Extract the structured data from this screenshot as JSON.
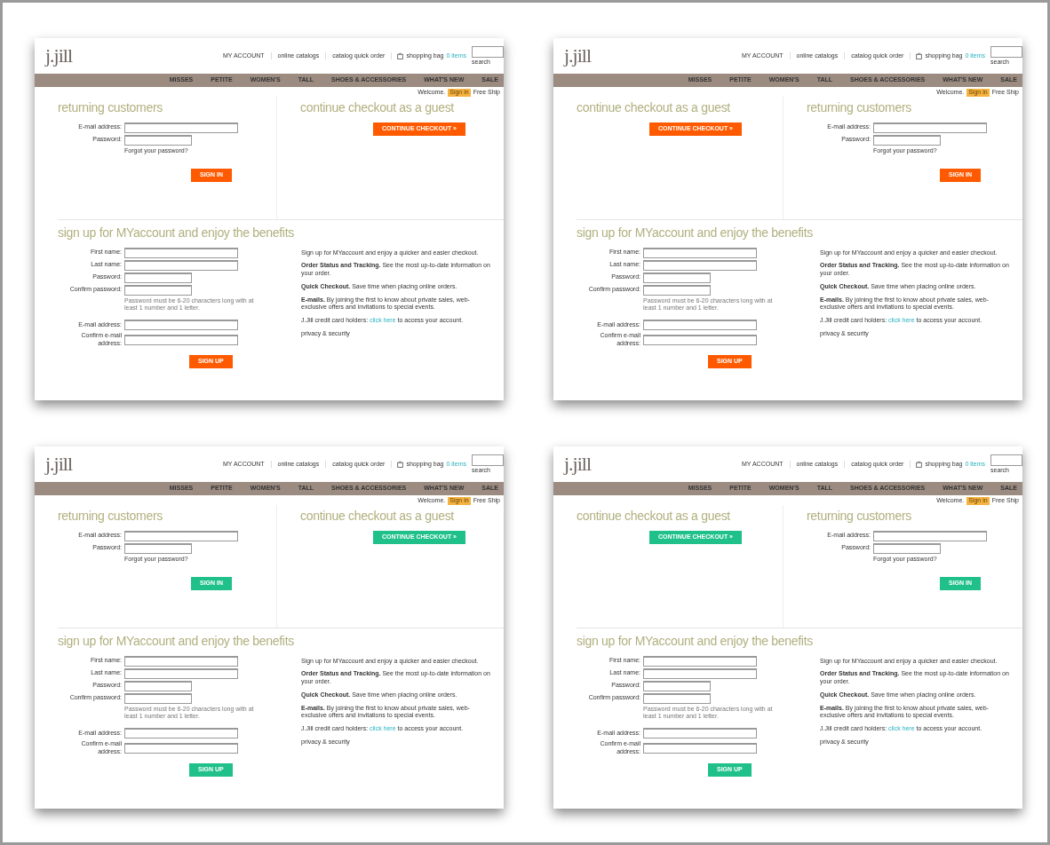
{
  "panels": [
    {
      "color": "#ff5a00",
      "logo": "j.jill",
      "utility_links": [
        "MY ACCOUNT",
        "online catalogs",
        "catalog quick order"
      ],
      "bag_label": "shopping bag",
      "bag_count": "0 items",
      "search_label": "search",
      "nav": [
        "MISSES",
        "PETITE",
        "WOMEN'S",
        "TALL",
        "SHOES & ACCESSORIES",
        "WHAT'S NEW",
        "SALE"
      ],
      "welcome": "Welcome.",
      "sign_in_link": "Sign in",
      "promo": "Free Ship",
      "sections": [
        {
          "kind": "returning",
          "heading": "returning customers",
          "fields": [
            "E-mail address:",
            "Password:"
          ],
          "forgot": "Forgot your password?",
          "button": "SIGN IN"
        },
        {
          "kind": "guest",
          "heading": "continue checkout as a guest",
          "button": "CONTINUE CHECKOUT »"
        }
      ],
      "signup": {
        "heading": "sign up for MYaccount and enjoy the benefits",
        "fields": [
          "First name:",
          "Last name:",
          "Password:",
          "Confirm password:"
        ],
        "hint": "Password must be 6-20 characters long with at least 1 number and 1 letter.",
        "email_fields": [
          "E-mail address:",
          "Confirm e-mail address:"
        ],
        "button": "SIGN UP",
        "intro": "Sign up for MYaccount and enjoy a quicker and easier checkout.",
        "benefits": [
          "**Order Status and Tracking.** See the most up-to-date information on your order.",
          "**Quick Checkout.** Save time when placing online orders.",
          "**E-mails.** By joining the first to know about private sales, web-exclusive offers and invitations to special events."
        ],
        "card_note": {
          "before": "J.Jill credit card holders:",
          "link": "click here",
          "after": "to access your account."
        },
        "privacy": "privacy & security"
      }
    },
    {
      "color": "#ff5a00",
      "logo": "j.jill",
      "utility_links": [
        "MY ACCOUNT",
        "online catalogs",
        "catalog quick order"
      ],
      "bag_label": "shopping bag",
      "bag_count": "0 items",
      "search_label": "search",
      "nav": [
        "MISSES",
        "PETITE",
        "WOMEN'S",
        "TALL",
        "SHOES & ACCESSORIES",
        "WHAT'S NEW",
        "SALE"
      ],
      "welcome": "Welcome.",
      "sign_in_link": "Sign in",
      "promo": "Free Ship",
      "sections": [
        {
          "kind": "guest",
          "heading": "continue checkout as a guest",
          "button": "CONTINUE CHECKOUT »"
        },
        {
          "kind": "returning",
          "heading": "returning customers",
          "fields": [
            "E-mail address:",
            "Password:"
          ],
          "forgot": "Forgot your password?",
          "button": "SIGN IN"
        }
      ],
      "signup": {
        "heading": "sign up for MYaccount and enjoy the benefits",
        "fields": [
          "First name:",
          "Last name:",
          "Password:",
          "Confirm password:"
        ],
        "hint": "Password must be 6-20 characters long with at least 1 number and 1 letter.",
        "email_fields": [
          "E-mail address:",
          "Confirm e-mail address:"
        ],
        "button": "SIGN UP",
        "intro": "Sign up for MYaccount and enjoy a quicker and easier checkout.",
        "benefits": [
          "**Order Status and Tracking.** See the most up-to-date information on your order.",
          "**Quick Checkout.** Save time when placing online orders.",
          "**E-mails.** By joining the first to know about private sales, web-exclusive offers and invitations to special events."
        ],
        "card_note": {
          "before": "J.Jill credit card holders:",
          "link": "click here",
          "after": "to access your account."
        },
        "privacy": "privacy & security"
      }
    },
    {
      "color": "#1fc08a",
      "logo": "j.jill",
      "utility_links": [
        "MY ACCOUNT",
        "online catalogs",
        "catalog quick order"
      ],
      "bag_label": "shopping bag",
      "bag_count": "0 items",
      "search_label": "search",
      "nav": [
        "MISSES",
        "PETITE",
        "WOMEN'S",
        "TALL",
        "SHOES & ACCESSORIES",
        "WHAT'S NEW",
        "SALE"
      ],
      "welcome": "Welcome.",
      "sign_in_link": "Sign in",
      "promo": "Free Ship",
      "sections": [
        {
          "kind": "returning",
          "heading": "returning customers",
          "fields": [
            "E-mail address:",
            "Password:"
          ],
          "forgot": "Forgot your password?",
          "button": "SIGN IN"
        },
        {
          "kind": "guest",
          "heading": "continue checkout as a guest",
          "button": "CONTINUE CHECKOUT »"
        }
      ],
      "signup": {
        "heading": "sign up for MYaccount and enjoy the benefits",
        "fields": [
          "First name:",
          "Last name:",
          "Password:",
          "Confirm password:"
        ],
        "hint": "Password must be 6-20 characters long with at least 1 number and 1 letter.",
        "email_fields": [
          "E-mail address:",
          "Confirm e-mail address:"
        ],
        "button": "SIGN UP",
        "intro": "Sign up for MYaccount and enjoy a quicker and easier checkout.",
        "benefits": [
          "**Order Status and Tracking.** See the most up-to-date information on your order.",
          "**Quick Checkout.** Save time when placing online orders.",
          "**E-mails.** By joining the first to know about private sales, web-exclusive offers and invitations to special events."
        ],
        "card_note": {
          "before": "J.Jill credit card holders:",
          "link": "click here",
          "after": "to access your account."
        },
        "privacy": "privacy & security"
      }
    },
    {
      "color": "#1fc08a",
      "logo": "j.jill",
      "utility_links": [
        "MY ACCOUNT",
        "online catalogs",
        "catalog quick order"
      ],
      "bag_label": "shopping bag",
      "bag_count": "0 items",
      "search_label": "search",
      "nav": [
        "MISSES",
        "PETITE",
        "WOMEN'S",
        "TALL",
        "SHOES & ACCESSORIES",
        "WHAT'S NEW",
        "SALE"
      ],
      "welcome": "Welcome.",
      "sign_in_link": "Sign in",
      "promo": "Free Ship",
      "sections": [
        {
          "kind": "guest",
          "heading": "continue checkout as a guest",
          "button": "CONTINUE CHECKOUT »"
        },
        {
          "kind": "returning",
          "heading": "returning customers",
          "fields": [
            "E-mail address:",
            "Password:"
          ],
          "forgot": "Forgot your password?",
          "button": "SIGN IN"
        }
      ],
      "signup": {
        "heading": "sign up for MYaccount and enjoy the benefits",
        "fields": [
          "First name:",
          "Last name:",
          "Password:",
          "Confirm password:"
        ],
        "hint": "Password must be 6-20 characters long with at least 1 number and 1 letter.",
        "email_fields": [
          "E-mail address:",
          "Confirm e-mail address:"
        ],
        "button": "SIGN UP",
        "intro": "Sign up for MYaccount and enjoy a quicker and easier checkout.",
        "benefits": [
          "**Order Status and Tracking.** See the most up-to-date information on your order.",
          "**Quick Checkout.** Save time when placing online orders.",
          "**E-mails.** By joining the first to know about private sales, web-exclusive offers and invitations to special events."
        ],
        "card_note": {
          "before": "J.Jill credit card holders:",
          "link": "click here",
          "after": "to access your account."
        },
        "privacy": "privacy & security"
      }
    }
  ]
}
